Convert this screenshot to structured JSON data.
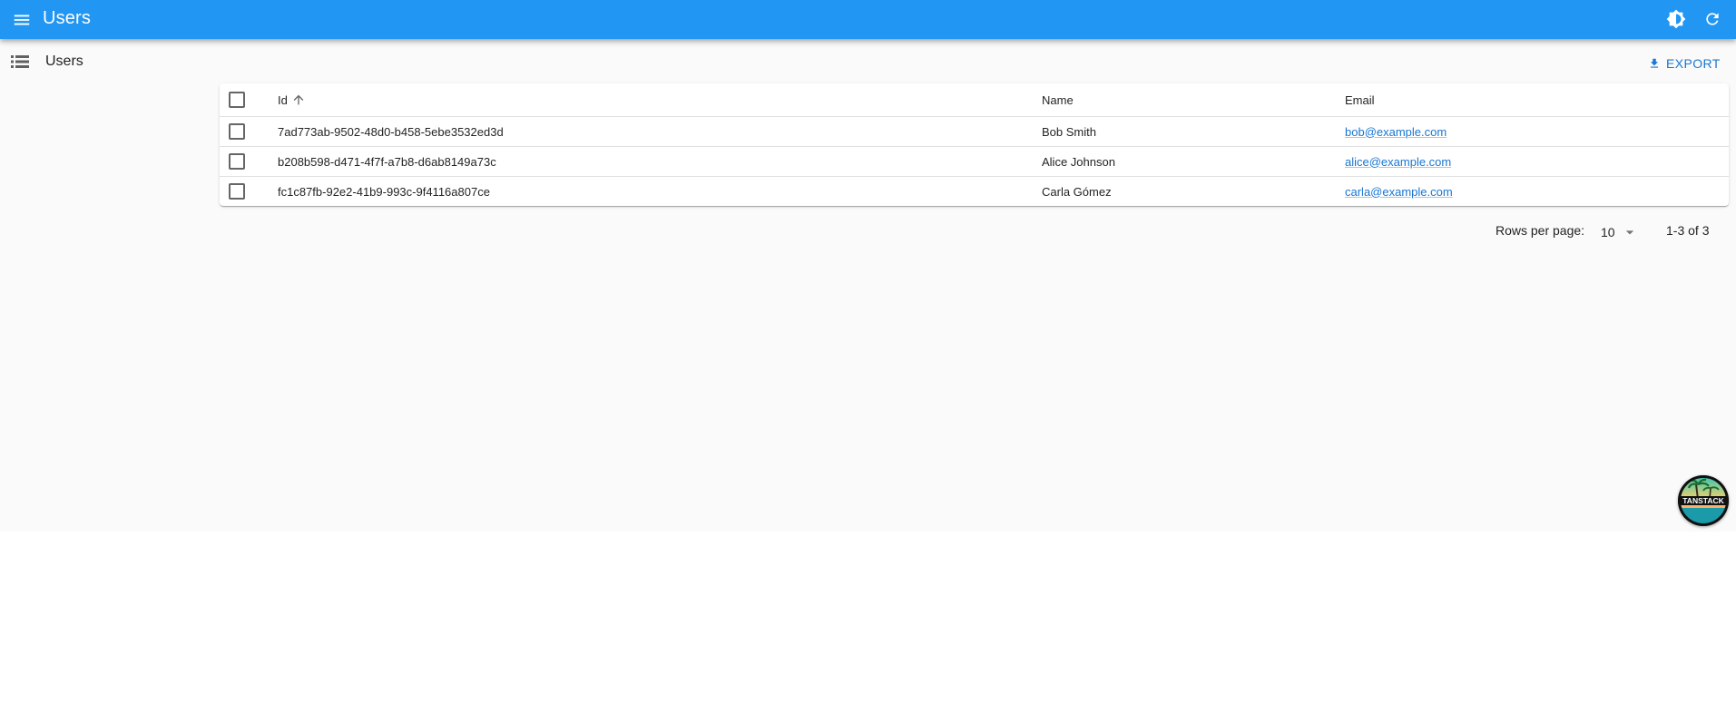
{
  "appbar": {
    "title": "Users",
    "menu_icon": "menu-icon",
    "theme_icon": "brightness-icon",
    "refresh_icon": "refresh-icon",
    "color": "#2196f3"
  },
  "list": {
    "title": "Users",
    "icon": "list-icon",
    "export_label": "EXPORT",
    "export_icon": "download-icon"
  },
  "table": {
    "columns": {
      "id": "Id",
      "name": "Name",
      "email": "Email"
    },
    "sort_column": "id",
    "sort_direction": "asc",
    "rows": [
      {
        "id": "7ad773ab-9502-48d0-b458-5ebe3532ed3d",
        "name": "Bob Smith",
        "email": "bob@example.com"
      },
      {
        "id": "b208b598-d471-4f7f-a7b8-d6ab8149a73c",
        "name": "Alice Johnson",
        "email": "alice@example.com"
      },
      {
        "id": "fc1c87fb-92e2-41b9-993c-9f4116a807ce",
        "name": "Carla Gómez",
        "email": "carla@example.com"
      }
    ]
  },
  "pagination": {
    "rows_per_page_label": "Rows per page:",
    "rows_per_page": "10",
    "range": "1-3 of 3"
  },
  "badge": {
    "label": "TANSTACK",
    "icon": "tanstack-devtools-icon"
  }
}
